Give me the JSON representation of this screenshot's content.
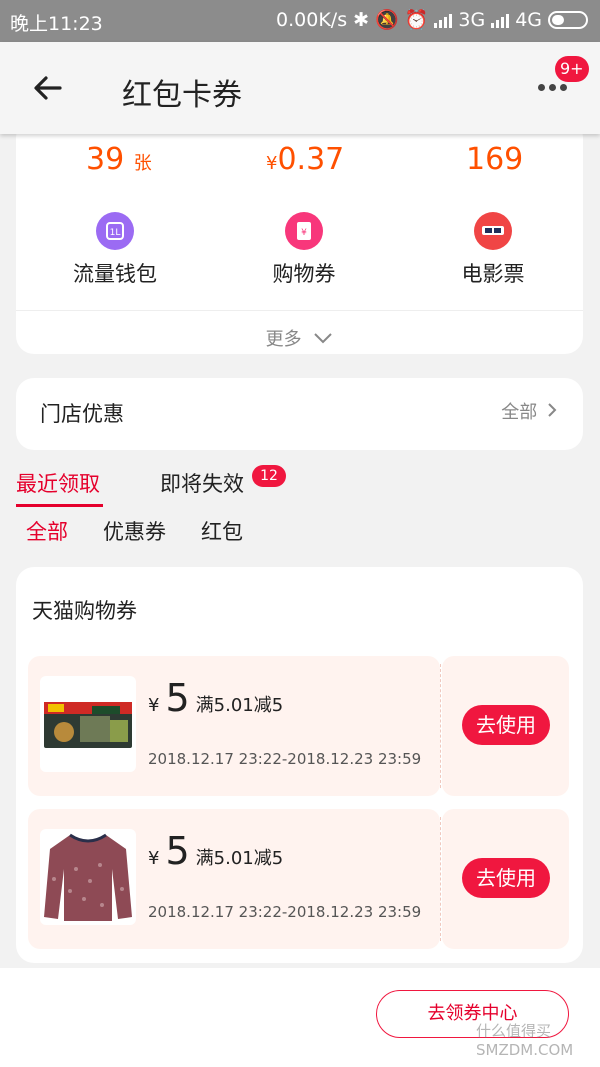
{
  "status_bar": {
    "time": "晚上11:23",
    "speed": "0.00K/s",
    "net1": "3G",
    "net2": "4G"
  },
  "header": {
    "title": "红包卡券",
    "more_badge": "9+"
  },
  "summary": {
    "stats": [
      {
        "value": "39",
        "unit": "张"
      },
      {
        "prefix": "¥",
        "value": "0.37"
      },
      {
        "value": "169"
      }
    ],
    "tools": [
      {
        "label": "流量钱包",
        "icon": "data-wallet-icon",
        "color": "#9b6bf3"
      },
      {
        "label": "购物券",
        "icon": "shopping-coupon-icon",
        "color": "#f8377b"
      },
      {
        "label": "电影票",
        "icon": "movie-ticket-icon",
        "color": "#f04545"
      }
    ],
    "more_label": "更多"
  },
  "store": {
    "title": "门店优惠",
    "all_label": "全部"
  },
  "tabs": {
    "recent": "最近领取",
    "expiring": "即将失效",
    "expiring_badge": "12"
  },
  "subtabs": [
    "全部",
    "优惠券",
    "红包"
  ],
  "list": {
    "title": "天猫购物券",
    "items": [
      {
        "currency": "¥",
        "amount": "5",
        "condition": "满5.01减5",
        "period": "2018.12.17 23:22-2018.12.23 23:59",
        "button": "去使用",
        "thumb": "lego-set-thumbnail"
      },
      {
        "currency": "¥",
        "amount": "5",
        "condition": "满5.01减5",
        "period": "2018.12.17 23:22-2018.12.23 23:59",
        "button": "去使用",
        "thumb": "sweater-thumbnail"
      }
    ]
  },
  "footer": {
    "center_button": "去领券中心"
  },
  "watermark": {
    "line1": "什么值得买",
    "line2": "SMZDM.COM"
  },
  "colors": {
    "accent": "#e5002c",
    "orange": "#ff5000",
    "coupon_bg": "#fff3ef"
  }
}
